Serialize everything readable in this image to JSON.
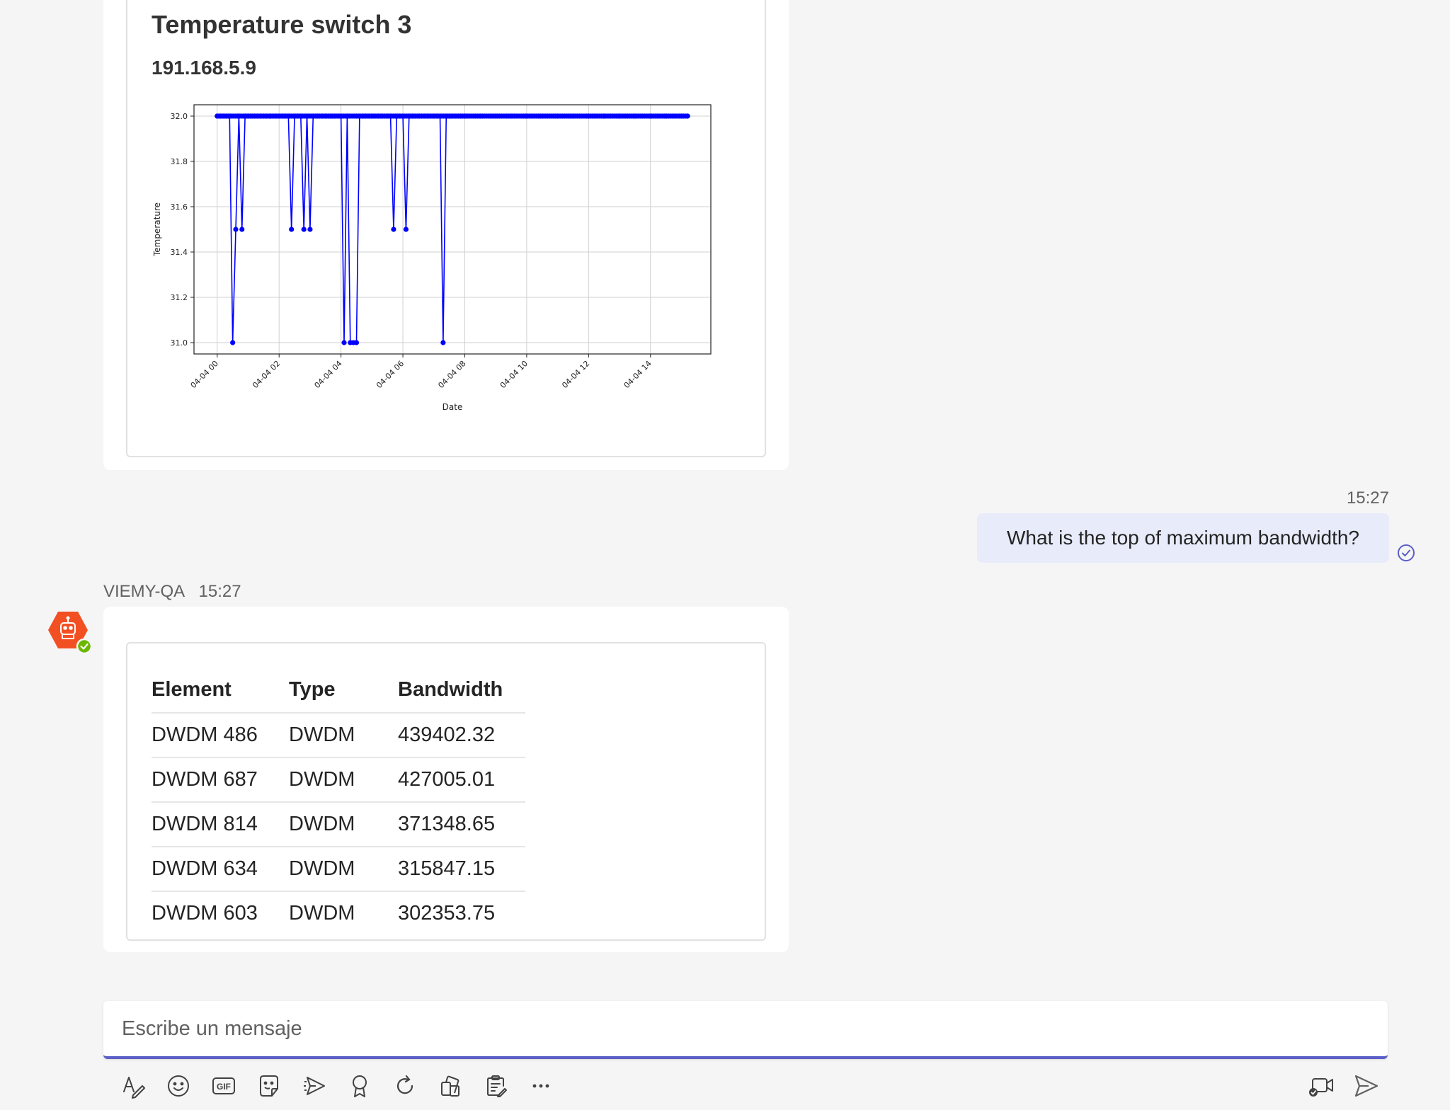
{
  "chart_card": {
    "title": "Temperature switch 3",
    "subtitle": "191.168.5.9"
  },
  "chart_data": {
    "type": "line",
    "title": "",
    "xlabel": "Date",
    "ylabel": "Temperature",
    "ylim": [
      30.95,
      32.05
    ],
    "yticks": [
      31.0,
      31.2,
      31.4,
      31.6,
      31.8,
      32.0
    ],
    "xticks": [
      "04-04 00",
      "04-04 02",
      "04-04 04",
      "04-04 06",
      "04-04 08",
      "04-04 10",
      "04-04 12",
      "04-04 14"
    ],
    "xlim_hours": [
      -0.75,
      15.95
    ],
    "grid": true,
    "marker": "circle",
    "color": "#0000ff",
    "series": [
      {
        "x_hours": [
          0.0,
          0.1,
          0.2,
          0.3,
          0.4,
          0.5,
          0.6,
          0.7,
          0.8,
          0.9,
          1.0,
          1.1,
          1.2,
          1.3,
          1.4,
          1.5,
          1.6,
          1.7,
          1.8,
          1.9,
          2.0,
          2.1,
          2.2,
          2.3,
          2.4,
          2.5,
          2.6,
          2.7,
          2.8,
          2.9,
          3.0,
          3.1,
          3.2,
          3.3,
          3.4,
          3.5,
          3.6,
          3.7,
          3.8,
          3.9,
          4.0,
          4.1,
          4.2,
          4.3,
          4.4,
          4.5,
          4.6,
          4.7,
          4.8,
          4.9,
          5.0,
          5.1,
          5.2,
          5.3,
          5.4,
          5.5,
          5.6,
          5.7,
          5.8,
          5.9,
          6.0,
          6.1,
          6.2,
          6.3,
          6.4,
          6.5,
          6.6,
          6.7,
          6.8,
          6.9,
          7.0,
          7.1,
          7.2,
          7.3,
          7.4,
          7.5,
          7.6,
          7.7,
          7.8,
          7.9,
          8.0,
          8.5,
          9.0,
          9.5,
          10.0,
          10.5,
          11.0,
          11.5,
          12.0,
          12.5,
          13.0,
          13.5,
          14.0,
          14.5,
          15.0,
          15.2
        ],
        "y": [
          32.0,
          32.0,
          32.0,
          32.0,
          32.0,
          31.0,
          31.5,
          32.0,
          31.5,
          32.0,
          32.0,
          32.0,
          32.0,
          32.0,
          32.0,
          32.0,
          32.0,
          32.0,
          32.0,
          32.0,
          32.0,
          32.0,
          32.0,
          32.0,
          31.5,
          32.0,
          32.0,
          32.0,
          31.5,
          32.0,
          31.5,
          32.0,
          32.0,
          32.0,
          32.0,
          32.0,
          32.0,
          32.0,
          32.0,
          32.0,
          32.0,
          31.0,
          32.0,
          31.0,
          31.0,
          31.0,
          32.0,
          32.0,
          32.0,
          32.0,
          32.0,
          32.0,
          32.0,
          32.0,
          32.0,
          32.0,
          32.0,
          31.5,
          32.0,
          32.0,
          32.0,
          31.5,
          32.0,
          32.0,
          32.0,
          32.0,
          32.0,
          32.0,
          32.0,
          32.0,
          32.0,
          32.0,
          32.0,
          31.0,
          32.0,
          32.0,
          32.0,
          32.0,
          32.0,
          32.0,
          32.0,
          32.0,
          32.0,
          32.0,
          32.0,
          32.0,
          32.0,
          32.0,
          32.0,
          32.0,
          32.0,
          32.0,
          32.0,
          32.0,
          32.0,
          32.0
        ]
      }
    ]
  },
  "user_message": {
    "time": "15:27",
    "text": "What is the top of maximum bandwidth?"
  },
  "bot_message": {
    "sender": "VIEMY-QA",
    "time": "15:27",
    "table": {
      "headers": [
        "Element",
        "Type",
        "Bandwidth"
      ],
      "rows": [
        [
          "DWDM 486",
          "DWDM",
          "439402.32"
        ],
        [
          "DWDM 687",
          "DWDM",
          "427005.01"
        ],
        [
          "DWDM 814",
          "DWDM",
          "371348.65"
        ],
        [
          "DWDM 634",
          "DWDM",
          "315847.15"
        ],
        [
          "DWDM 603",
          "DWDM",
          "302353.75"
        ]
      ]
    }
  },
  "compose": {
    "placeholder": "Escribe un mensaje"
  },
  "toolbar": {
    "icons": [
      "format-icon",
      "emoji-icon",
      "gif-icon",
      "sticker-icon",
      "schedule-send-icon",
      "praise-icon",
      "loop-icon",
      "apps-icon",
      "forms-icon",
      "more-options-icon"
    ],
    "gif_label": "GIF",
    "right_icons": [
      "meet-now-icon",
      "send-icon"
    ]
  },
  "colors": {
    "accent": "#5b5fc7",
    "user_bubble": "#e8ebfa",
    "avatar": "#f25022",
    "presence": "#6bb700",
    "series": "#0000ff"
  }
}
